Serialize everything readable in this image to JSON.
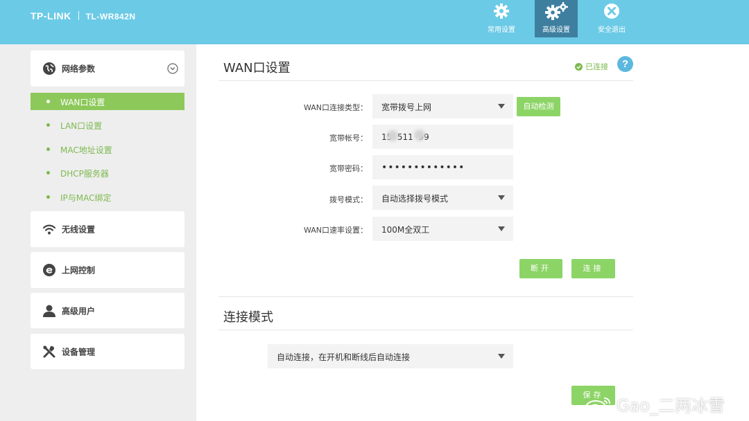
{
  "header": {
    "brand": "TP-LINK",
    "model": "TL-WR842N",
    "nav": [
      {
        "label": "常用设置",
        "icon": "gear-icon"
      },
      {
        "label": "高级设置",
        "icon": "gears-icon"
      },
      {
        "label": "安全退出",
        "icon": "close-circle-icon"
      }
    ],
    "active_nav": "高级设置"
  },
  "sidebar": {
    "sections": [
      {
        "label": "网络参数",
        "icon": "globe-icon",
        "expanded": true
      },
      {
        "label": "无线设置",
        "icon": "wifi-icon"
      },
      {
        "label": "上网控制",
        "icon": "internet-e-icon"
      },
      {
        "label": "高级用户",
        "icon": "user-icon"
      },
      {
        "label": "设备管理",
        "icon": "tools-icon"
      }
    ],
    "subitems": [
      {
        "label": "WAN口设置",
        "active": true
      },
      {
        "label": "LAN口设置"
      },
      {
        "label": "MAC地址设置"
      },
      {
        "label": "DHCP服务器"
      },
      {
        "label": "IP与MAC绑定"
      }
    ]
  },
  "wan": {
    "title": "WAN口设置",
    "status": "已连接",
    "help": "?",
    "conn_type_label": "WAN口连接类型：",
    "conn_type_value": "宽带拨号上网",
    "auto_detect": "自动检测",
    "account_label": "宽带帐号：",
    "account_value": "15  511  99",
    "password_label": "宽带密码：",
    "password_value": "•••••••••••••",
    "dial_label": "拨号模式：",
    "dial_value": "自动选择拨号模式",
    "speed_label": "WAN口速率设置：",
    "speed_value": "100M全双工",
    "disconnect": "断开",
    "connect": "连接"
  },
  "mode": {
    "title": "连接模式",
    "value": "自动连接，在开机和断线后自动连接",
    "save": "保存"
  },
  "watermark": "Gao_二两冰雪",
  "colors": {
    "header_bg": "#6bcae6",
    "nav_active": "#3e7fa0",
    "accent_green": "#8dd467",
    "sidebar_active": "#8dc95a",
    "help_blue": "#5cb8de"
  }
}
